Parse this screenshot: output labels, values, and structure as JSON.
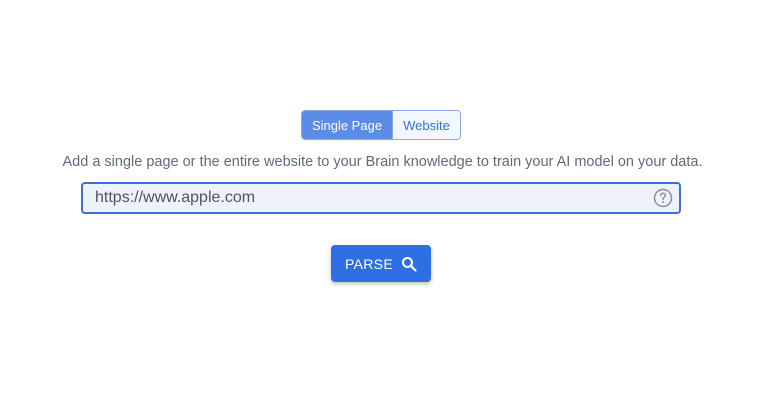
{
  "mode_toggle": {
    "options": [
      {
        "label": "Single Page",
        "selected": true
      },
      {
        "label": "Website",
        "selected": false
      }
    ]
  },
  "description": "Add a single page or the entire website to your Brain knowledge to train your AI model on your data.",
  "url_input": {
    "value": "https://www.apple.com",
    "help_icon": "question-circle-icon"
  },
  "parse_button": {
    "label": "PARSE",
    "icon": "search-icon"
  },
  "colors": {
    "accent": "#2f6fe4",
    "toggle_active": "#5b8de8",
    "input_background": "#eef2fb",
    "text_muted": "#5f6b7a"
  }
}
